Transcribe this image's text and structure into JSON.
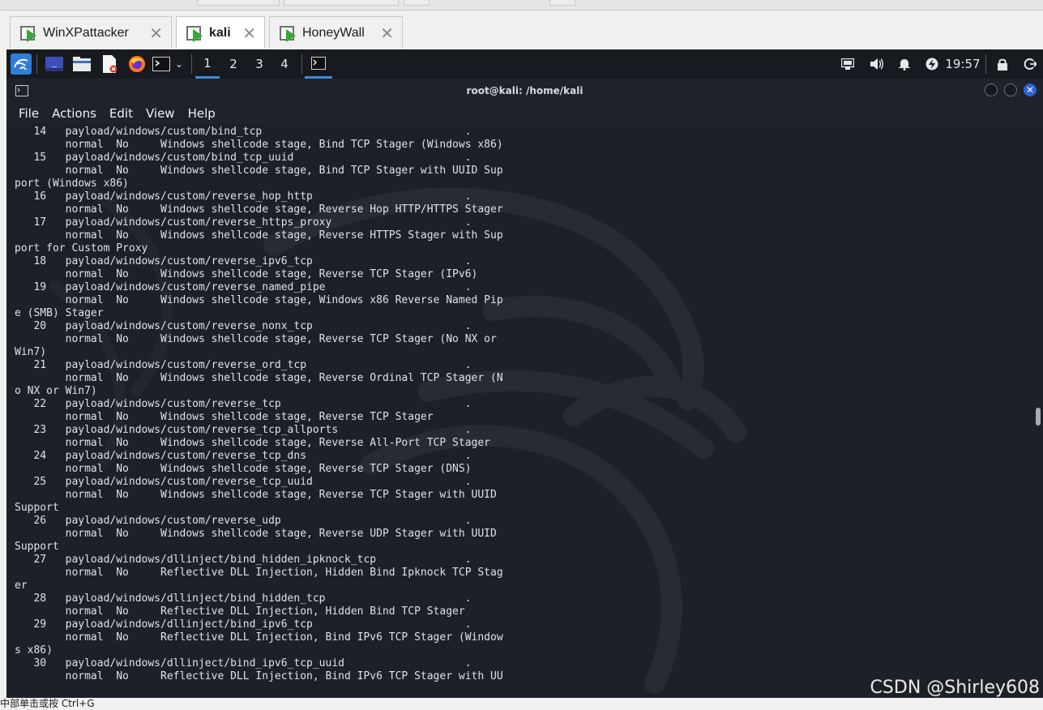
{
  "vm_tabs": [
    {
      "label": "WinXPattacker",
      "active": false
    },
    {
      "label": "kali",
      "active": true
    },
    {
      "label": "HoneyWall",
      "active": false
    }
  ],
  "panel": {
    "workspaces": [
      "1",
      "2",
      "3",
      "4"
    ],
    "active_workspace": "1",
    "clock": "19:57",
    "icons": [
      "kali-menu-icon",
      "desktop-icon",
      "file-manager-icon",
      "text-editor-icon",
      "firefox-icon",
      "terminal-icon",
      "chevron-down-icon",
      "terminal-window-icon",
      "network-icon",
      "volume-icon",
      "notification-bell-icon",
      "power-manager-icon",
      "lock-icon",
      "logout-icon"
    ]
  },
  "terminal": {
    "title": "root@kali: /home/kali",
    "menu": [
      "File",
      "Actions",
      "Edit",
      "View",
      "Help"
    ],
    "lines": [
      "   14   payload/windows/custom/bind_tcp                                .",
      "        normal  No     Windows shellcode stage, Bind TCP Stager (Windows x86)",
      "   15   payload/windows/custom/bind_tcp_uuid                           .",
      "        normal  No     Windows shellcode stage, Bind TCP Stager with UUID Sup",
      "port (Windows x86)",
      "   16   payload/windows/custom/reverse_hop_http                        .",
      "        normal  No     Windows shellcode stage, Reverse Hop HTTP/HTTPS Stager",
      "   17   payload/windows/custom/reverse_https_proxy                     .",
      "        normal  No     Windows shellcode stage, Reverse HTTPS Stager with Sup",
      "port for Custom Proxy",
      "   18   payload/windows/custom/reverse_ipv6_tcp                        .",
      "        normal  No     Windows shellcode stage, Reverse TCP Stager (IPv6)",
      "   19   payload/windows/custom/reverse_named_pipe                      .",
      "        normal  No     Windows shellcode stage, Windows x86 Reverse Named Pip",
      "e (SMB) Stager",
      "   20   payload/windows/custom/reverse_nonx_tcp                        .",
      "        normal  No     Windows shellcode stage, Reverse TCP Stager (No NX or",
      "Win7)",
      "   21   payload/windows/custom/reverse_ord_tcp                         .",
      "        normal  No     Windows shellcode stage, Reverse Ordinal TCP Stager (N",
      "o NX or Win7)",
      "   22   payload/windows/custom/reverse_tcp                             .",
      "        normal  No     Windows shellcode stage, Reverse TCP Stager",
      "   23   payload/windows/custom/reverse_tcp_allports                    .",
      "        normal  No     Windows shellcode stage, Reverse All-Port TCP Stager",
      "   24   payload/windows/custom/reverse_tcp_dns                         .",
      "        normal  No     Windows shellcode stage, Reverse TCP Stager (DNS)",
      "   25   payload/windows/custom/reverse_tcp_uuid                        .",
      "        normal  No     Windows shellcode stage, Reverse TCP Stager with UUID",
      "Support",
      "   26   payload/windows/custom/reverse_udp                             .",
      "        normal  No     Windows shellcode stage, Reverse UDP Stager with UUID",
      "Support",
      "   27   payload/windows/dllinject/bind_hidden_ipknock_tcp              .",
      "        normal  No     Reflective DLL Injection, Hidden Bind Ipknock TCP Stag",
      "er",
      "   28   payload/windows/dllinject/bind_hidden_tcp                      .",
      "        normal  No     Reflective DLL Injection, Hidden Bind TCP Stager",
      "   29   payload/windows/dllinject/bind_ipv6_tcp                        .",
      "        normal  No     Reflective DLL Injection, Bind IPv6 TCP Stager (Window",
      "s x86)",
      "   30   payload/windows/dllinject/bind_ipv6_tcp_uuid                   .",
      "        normal  No     Reflective DLL Injection, Bind IPv6 TCP Stager with UU"
    ]
  },
  "status_bar": {
    "hint": "中部单击或按 Ctrl+G"
  },
  "watermark": "CSDN @Shirley608",
  "colors": {
    "terminal_bg": "#1c2028",
    "panel_bg": "#171a1f",
    "accent": "#3d8bd9",
    "close_button": "#2a63d4"
  }
}
